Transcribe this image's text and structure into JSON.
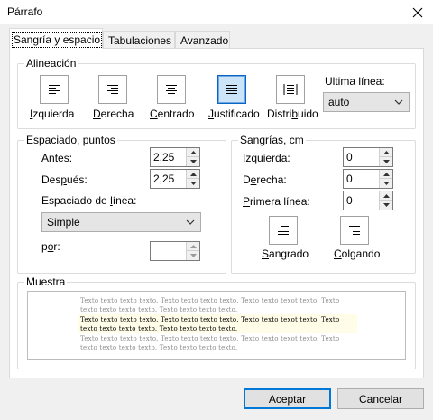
{
  "window": {
    "title": "Párrafo"
  },
  "tabs": [
    {
      "label": "Sangría y espacio",
      "active": true
    },
    {
      "label": "Tabulaciones",
      "active": false
    },
    {
      "label": "Avanzado",
      "active": false
    }
  ],
  "alignment": {
    "group_label": "Alineación",
    "buttons": [
      {
        "label": "Izquierda",
        "icon": "align-left-icon",
        "selected": false
      },
      {
        "label": "Derecha",
        "icon": "align-right-icon",
        "selected": false
      },
      {
        "label": "Centrado",
        "icon": "align-center-icon",
        "selected": false
      },
      {
        "label": "Justificado",
        "icon": "align-justify-icon",
        "selected": true
      },
      {
        "label": "Distribuido",
        "icon": "align-distributed-icon",
        "selected": false
      }
    ],
    "last_line_label": "Ultima línea:",
    "last_line_value": "auto"
  },
  "spacing": {
    "group_label": "Espaciado, puntos",
    "before_label": "Antes:",
    "before_value": "2,25",
    "after_label": "Después:",
    "after_value": "2,25",
    "line_spacing_label": "Espaciado de línea:",
    "line_spacing_value": "Simple",
    "by_label": "por:",
    "by_value": ""
  },
  "indents": {
    "group_label": "Sangrías, cm",
    "left_label": "Izquierda:",
    "left_value": "0",
    "right_label": "Derecha:",
    "right_value": "0",
    "first_line_label": "Primera línea:",
    "first_line_value": "0",
    "indent_button_label": "Sangrado",
    "hanging_button_label": "Colgando"
  },
  "preview": {
    "group_label": "Muestra",
    "lines": [
      "Texto texto texto texto. Texto texto texto texto. Texto texto texot texto. Texto",
      "texto texto texto texto. Texto texto texto texto.",
      "Texto texto texto texto. Texto texto texto texto. Texto texto texot texto. Texto",
      "texto texto texto texto. Texto texto texto texto.",
      "Texto texto texto texto. Texto texto texto texto. Texto texto texot texto. Texto",
      "texto texto texto texto. Texto texto texto texto."
    ]
  },
  "footer": {
    "ok_label": "Aceptar",
    "cancel_label": "Cancelar"
  },
  "colors": {
    "accent": "#0078d7",
    "selected_bg": "#cce4f7",
    "preview_highlight": "#fffde8"
  }
}
